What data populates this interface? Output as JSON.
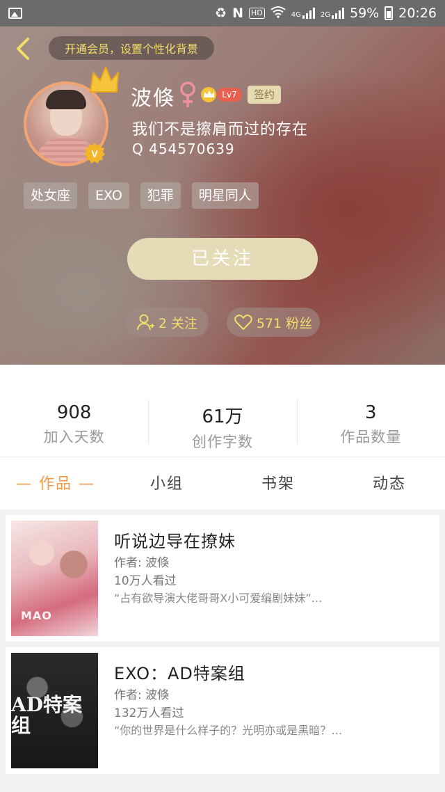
{
  "status_bar": {
    "hd": "HD",
    "net1": "4G",
    "net2": "2G",
    "battery": "59%",
    "time": "20:26"
  },
  "header": {
    "vip_banner": "开通会员，设置个性化背景",
    "nickname": "波倏",
    "level": "Lv7",
    "sign_badge": "签约",
    "bio": "我们不是擦肩而过的存在",
    "qq": "Q 454570639",
    "tags": [
      "处女座",
      "EXO",
      "犯罪",
      "明星同人"
    ],
    "follow_button": "已关注",
    "following": "2 关注",
    "fans": "571 粉丝"
  },
  "stats": [
    {
      "value": "908",
      "label": "加入天数"
    },
    {
      "value": "61万",
      "label": "创作字数"
    },
    {
      "value": "3",
      "label": "作品数量"
    }
  ],
  "tabs": [
    "— 作品 —",
    "小组",
    "书架",
    "动态"
  ],
  "works": [
    {
      "title": "听说边导在撩妹",
      "author": "作者: 波倏",
      "views": "10万人看过",
      "desc": "“占有欲导演大佬哥哥X小可爱编剧妹妹”…",
      "cover_text": "MAO"
    },
    {
      "title": "EXO：AD特案组",
      "author": "作者: 波倏",
      "views": "132万人看过",
      "desc": "“你的世界是什么样子的？光明亦或是黑暗？…",
      "cover_text": "AD特案组"
    }
  ],
  "colors": {
    "accent": "#f29a47",
    "vip_text": "#f3de6a",
    "follow_btn": "#e5dbb7"
  }
}
